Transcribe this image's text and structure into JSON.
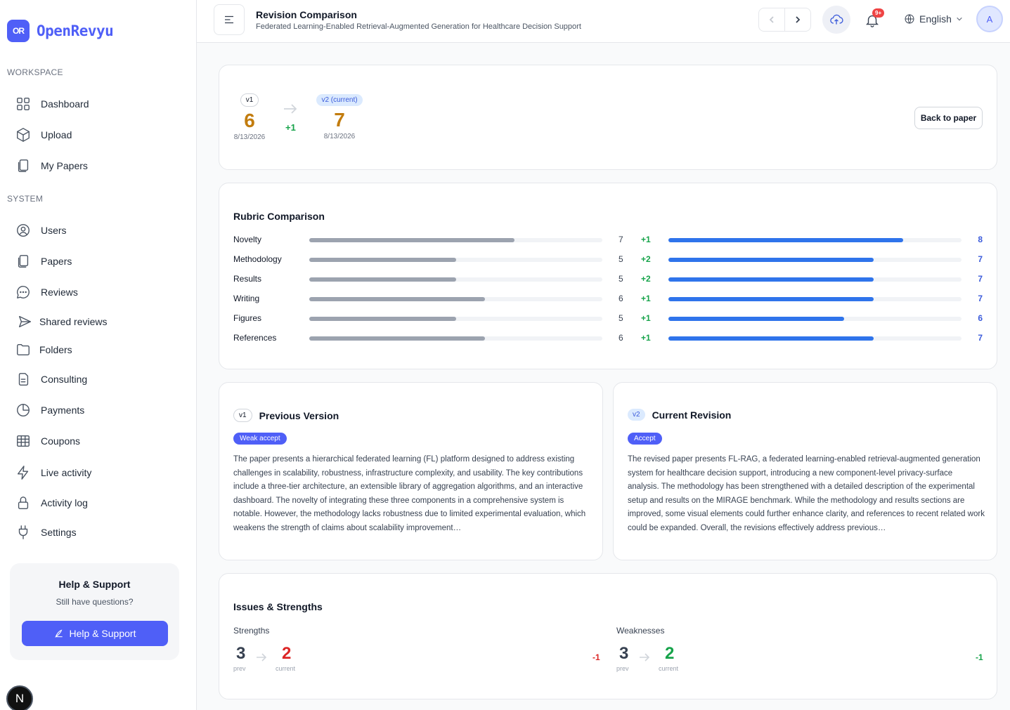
{
  "app": {
    "logo_mark": "OR",
    "name": "OpenRevyu"
  },
  "sidebar": {
    "workspace_label": "WORKSPACE",
    "system_label": "SYSTEM",
    "workspace_items": [
      {
        "label": "Dashboard",
        "icon": "grid-icon"
      },
      {
        "label": "Upload",
        "icon": "box-icon"
      },
      {
        "label": "My Papers",
        "icon": "documents-icon"
      }
    ],
    "system_items": [
      {
        "label": "Users",
        "icon": "user-circle-icon"
      },
      {
        "label": "Papers",
        "icon": "documents-icon"
      },
      {
        "label": "Reviews",
        "icon": "chat-bubble-icon"
      },
      {
        "label": "Shared reviews",
        "icon": "send-icon"
      },
      {
        "label": "Folders",
        "icon": "folder-icon"
      },
      {
        "label": "Consulting",
        "icon": "clipboard-icon"
      },
      {
        "label": "Payments",
        "icon": "pie-chart-icon"
      },
      {
        "label": "Coupons",
        "icon": "table-icon"
      },
      {
        "label": "Live activity",
        "icon": "lightning-icon"
      },
      {
        "label": "Activity log",
        "icon": "lock-icon"
      },
      {
        "label": "Settings",
        "icon": "plug-icon"
      }
    ],
    "help": {
      "title": "Help & Support",
      "subtitle": "Still have questions?",
      "button": "Help & Support"
    },
    "footer_avatar": "N"
  },
  "header": {
    "title": "Revision Comparison",
    "subtitle": "Federated Learning-Enabled Retrieval-Augmented Generation for Healthcare Decision Support",
    "notification_badge": "9+",
    "language": "English",
    "avatar_initial": "A"
  },
  "score_summary": {
    "v1": {
      "label": "v1",
      "score": "6",
      "date": "8/13/2026"
    },
    "delta": "+1",
    "v2": {
      "label": "v2 (current)",
      "score": "7",
      "date": "8/13/2026"
    },
    "back_button": "Back to paper"
  },
  "rubric": {
    "title": "Rubric Comparison",
    "max_score": 10,
    "rows": [
      {
        "label": "Novelty",
        "prev": 7,
        "delta": "+1",
        "current": 8
      },
      {
        "label": "Methodology",
        "prev": 5,
        "delta": "+2",
        "current": 7
      },
      {
        "label": "Results",
        "prev": 5,
        "delta": "+2",
        "current": 7
      },
      {
        "label": "Writing",
        "prev": 6,
        "delta": "+1",
        "current": 7
      },
      {
        "label": "Figures",
        "prev": 5,
        "delta": "+1",
        "current": 6
      },
      {
        "label": "References",
        "prev": 6,
        "delta": "+1",
        "current": 7
      }
    ]
  },
  "previous_version": {
    "pill": "v1",
    "title": "Previous Version",
    "decision": "Weak accept",
    "summary": "The paper presents a hierarchical federated learning (FL) platform designed to address existing challenges in scalability, robustness, infrastructure complexity, and usability. The key contributions include a three-tier architecture, an extensible library of aggregation algorithms, and an interactive dashboard. The novelty of integrating these three components in a comprehensive system is notable. However, the methodology lacks robustness due to limited experimental evaluation, which weakens the strength of claims about scalability improvement…"
  },
  "current_revision": {
    "pill": "v2",
    "title": "Current Revision",
    "decision": "Accept",
    "summary": "The revised paper presents FL-RAG, a federated learning-enabled retrieval-augmented generation system for healthcare decision support, introducing a new component-level privacy-surface analysis. The methodology has been strengthened with a detailed description of the experimental setup and results on the MIRAGE benchmark. While the methodology and results sections are improved, some visual elements could further enhance clarity, and references to recent related work could be expanded. Overall, the revisions effectively address previous…"
  },
  "issues_strengths": {
    "title": "Issues & Strengths",
    "strengths": {
      "label": "Strengths",
      "prev": "3",
      "current": "2",
      "delta": "-1",
      "prev_label": "prev",
      "current_label": "current"
    },
    "weaknesses": {
      "label": "Weaknesses",
      "prev": "3",
      "current": "2",
      "delta": "-1",
      "prev_label": "prev",
      "current_label": "current"
    }
  },
  "colors": {
    "accent": "#4f5ff7",
    "score": "#c27c0e",
    "positive": "#16a34a",
    "negative": "#dc2626",
    "bar_prev": "#9ca3af",
    "bar_current": "#2f74eb"
  }
}
